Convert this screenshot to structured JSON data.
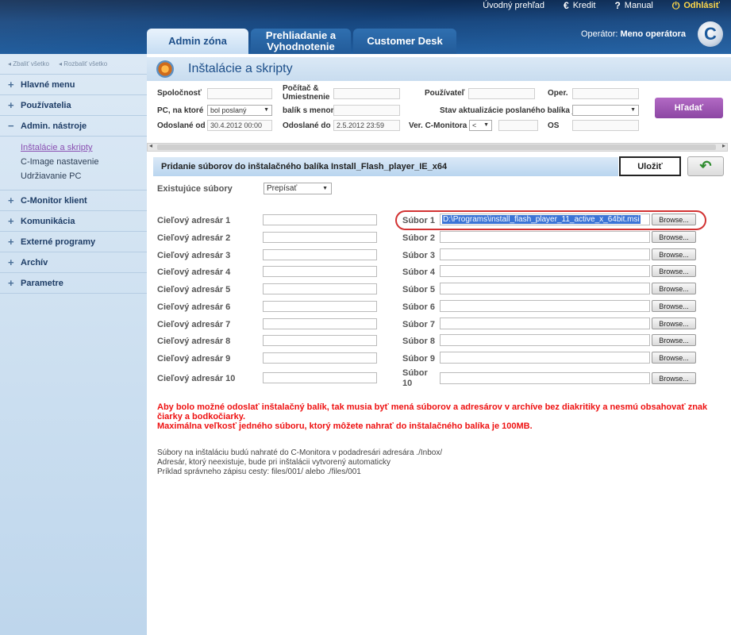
{
  "header": {
    "links": [
      {
        "label": "Úvodný prehľad",
        "icon": "none"
      },
      {
        "label": "Kredit",
        "icon": "euro-icon"
      },
      {
        "label": "Manual",
        "icon": "help-icon"
      },
      {
        "label": "Odhlásiť",
        "icon": "power-icon"
      }
    ],
    "tabs": [
      {
        "label": "Admin zóna"
      },
      {
        "label": "Prehliadanie a Vyhodnotenie"
      },
      {
        "label": "Customer Desk"
      }
    ],
    "operator_label": "Operátor:",
    "operator_name": "Meno operátora",
    "logo_letter": "C"
  },
  "sidebar": {
    "collapse_all": "Zbaliť všetko",
    "expand_all": "Rozbaliť všetko",
    "items_top": [
      {
        "label": "Hlavné menu",
        "toggle": "+"
      },
      {
        "label": "Používatelia",
        "toggle": "+"
      },
      {
        "label": "Admin. nástroje",
        "toggle": "−"
      }
    ],
    "sub_items": [
      {
        "label": "Inštalácie a skripty",
        "selected": true
      },
      {
        "label": "C-Image nastavenie",
        "selected": false
      },
      {
        "label": "Udržiavanie PC",
        "selected": false
      }
    ],
    "items_bottom": [
      {
        "label": "C-Monitor klient",
        "toggle": "+"
      },
      {
        "label": "Komunikácia",
        "toggle": "+"
      },
      {
        "label": "Externé programy",
        "toggle": "+"
      },
      {
        "label": "Archív",
        "toggle": "+"
      },
      {
        "label": "Parametre",
        "toggle": "+"
      }
    ]
  },
  "page": {
    "title": "Inštalácie a skripty"
  },
  "filters": {
    "company": "Spoločnosť",
    "computer_location": "Počítač & Umiestnenie",
    "user": "Používateľ",
    "oper": "Oper.",
    "pc_on_which": "PC, na ktoré",
    "pc_on_which_value": "bol poslaný",
    "package_name": "balík s menom",
    "update_state": "Stav aktualizácie poslaného balíka je",
    "sent_from": "Odoslané od",
    "sent_from_value": "30.4.2012 00:00",
    "sent_to": "Odoslané do",
    "sent_to_value": "2.5.2012 23:59",
    "cmonitor_ver": "Ver. C-Monitora",
    "cmonitor_ver_op": "<",
    "os": "OS",
    "search_button": "Hľadať"
  },
  "form": {
    "section_title": "Pridanie súborov do inštalačného balíka Install_Flash_player_IE_x64",
    "save_button": "Uložiť",
    "existing_files_label": "Existujúce súbory",
    "existing_files_value": "Prepísať",
    "browse_label": "Browse...",
    "rows": [
      {
        "dir_label": "Cieľový adresár 1",
        "file_label": "Súbor 1",
        "file_value": "D:\\Programs\\install_flash_player_11_active_x_64bit.msi"
      },
      {
        "dir_label": "Cieľový adresár 2",
        "file_label": "Súbor 2",
        "file_value": ""
      },
      {
        "dir_label": "Cieľový adresár 3",
        "file_label": "Súbor 3",
        "file_value": ""
      },
      {
        "dir_label": "Cieľový adresár 4",
        "file_label": "Súbor 4",
        "file_value": ""
      },
      {
        "dir_label": "Cieľový adresár 5",
        "file_label": "Súbor 5",
        "file_value": ""
      },
      {
        "dir_label": "Cieľový adresár 6",
        "file_label": "Súbor 6",
        "file_value": ""
      },
      {
        "dir_label": "Cieľový adresár 7",
        "file_label": "Súbor 7",
        "file_value": ""
      },
      {
        "dir_label": "Cieľový adresár 8",
        "file_label": "Súbor 8",
        "file_value": ""
      },
      {
        "dir_label": "Cieľový adresár 9",
        "file_label": "Súbor 9",
        "file_value": ""
      },
      {
        "dir_label": "Cieľový adresár 10",
        "file_label": "Súbor 10",
        "file_value": ""
      }
    ],
    "warning_line1": "Aby bolo možné odoslať inštalačný balík, tak musia byť mená súborov a adresárov v archíve bez diakritiky a nesmú obsahovať znak čiarky a bodkočiarky.",
    "warning_line2": "Maximálna veľkosť jedného súboru, ktorý môžete nahrať do inštalačného balíka je 100MB.",
    "info_line1": "Súbory na inštaláciu budú nahraté do C-Monitora v podadresári adresára ./Inbox/",
    "info_line2": "Adresár, ktorý neexistuje, bude pri inštalácii vytvorený automaticky",
    "info_line3": "Príklad správneho zápisu cesty: files/001/ alebo ./files/001"
  }
}
